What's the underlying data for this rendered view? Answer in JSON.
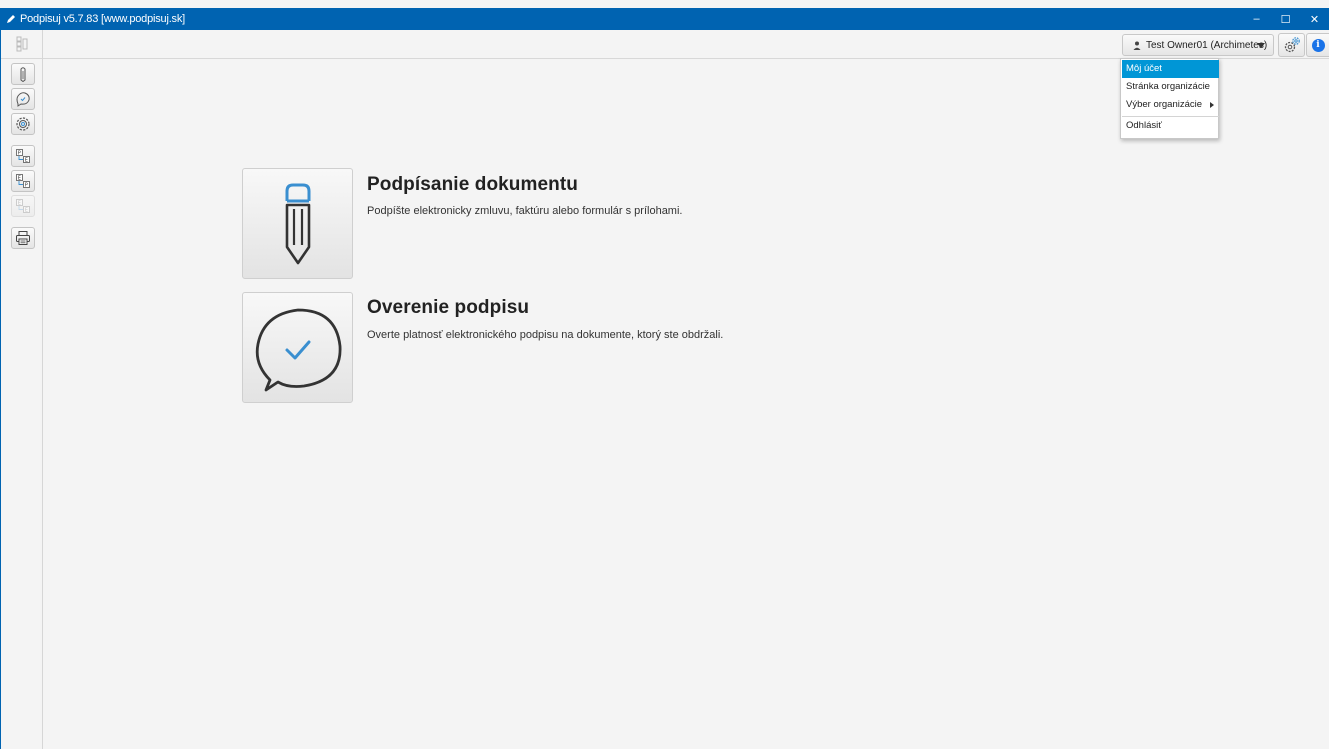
{
  "window": {
    "title": "Podpisuj v5.7.83 [www.podpisuj.sk]",
    "controls": {
      "minimize": "–",
      "maximize": "☐",
      "close": "✕"
    }
  },
  "user_menu": {
    "user_label": "Test Owner01 (Archimetes)",
    "items": [
      {
        "label": "Môj účet",
        "active": true
      },
      {
        "label": "Stránka organizácie"
      },
      {
        "label": "Výber organizácie",
        "submenu": true
      },
      {
        "label": "Odhlásiť"
      }
    ]
  },
  "toolbar": {
    "info_glyph": "i"
  },
  "sidebar": {
    "tools": [
      {
        "icon": "paperclip-pen-icon"
      },
      {
        "icon": "verify-bubble-icon"
      },
      {
        "icon": "gear-icon"
      },
      {
        "icon": "export-p-icon"
      },
      {
        "icon": "export-e-icon"
      },
      {
        "icon": "export-disabled-icon",
        "disabled": true
      },
      {
        "icon": "printer-icon"
      }
    ]
  },
  "actions": [
    {
      "title": "Podpísanie dokumentu",
      "description": "Podpíšte elektronicky zmluvu, faktúru alebo formulár s prílohami.",
      "icon": "pen-icon"
    },
    {
      "title": "Overenie podpisu",
      "description": "Overte platnosť elektronického podpisu na dokumente, ktorý ste obdržali.",
      "icon": "check-bubble-icon"
    }
  ],
  "colors": {
    "titlebar": "#0063b1",
    "menu_highlight": "#0096d6",
    "icon_accent": "#3a8fd0",
    "info": "#1a73e8"
  }
}
